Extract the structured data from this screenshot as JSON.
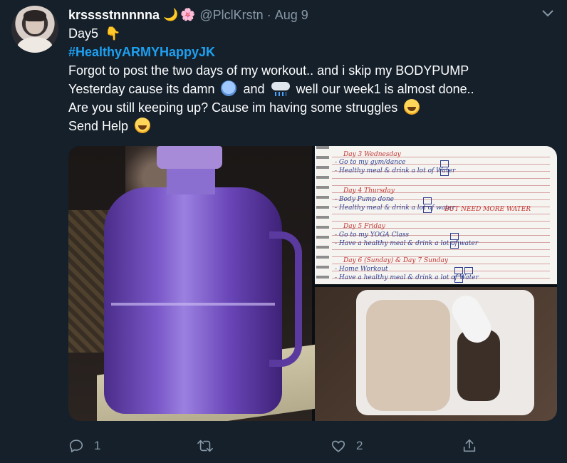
{
  "tweet": {
    "display_name": "krsssstnnnnna",
    "name_emojis": [
      "🌙",
      "🌸"
    ],
    "handle": "@PlclKrstn",
    "separator": "·",
    "date": "Aug 9",
    "text_lines": [
      "Day5",
      "#HealthyARMYHappyJK",
      "Forgot to post the two days of my workout.. and i skip my BODYPUMP",
      "Yesterday cause its damn",
      "and",
      "well our week1 is almost done..",
      "Are you still keeping up? Cause im having some struggles",
      "Send Help"
    ],
    "hand_emoji": "👇",
    "icons": {
      "more": "chevron-down-icon",
      "reply": "reply-icon",
      "retweet": "retweet-icon",
      "like": "heart-icon",
      "share": "share-icon"
    },
    "counts": {
      "reply": "1",
      "retweet": "",
      "like": "2"
    }
  },
  "notebook": {
    "entries": [
      {
        "line": "Day 3   Wednesday",
        "color": "red"
      },
      {
        "line": "- Go to my gym/dance",
        "color": "blue"
      },
      {
        "line": "- Healthy meal & drink a lot of Water",
        "color": "blue"
      },
      {
        "line": "Day 4   Thursday",
        "color": "red"
      },
      {
        "line": "- Body Pump   done",
        "color": "blue"
      },
      {
        "line": "- Healthy meal & drink a lot of water",
        "color": "blue"
      },
      {
        "line": "BUT NEED MORE WATER",
        "color": "red"
      },
      {
        "line": "Day 5   Friday",
        "color": "red"
      },
      {
        "line": "- Go to my YOGA Class",
        "color": "blue"
      },
      {
        "line": "- Have a healthy meal & drink a lot of water",
        "color": "blue"
      },
      {
        "line": "Day 6  (Sunday)  &  Day 7  Sunday",
        "color": "red"
      },
      {
        "line": "- Home Workout",
        "color": "blue"
      },
      {
        "line": "- Have a healthy meal & drink a lot of Water",
        "color": "blue"
      }
    ]
  },
  "colors": {
    "background": "#15202b",
    "secondary_text": "#8899a6",
    "link": "#1da1f2"
  }
}
